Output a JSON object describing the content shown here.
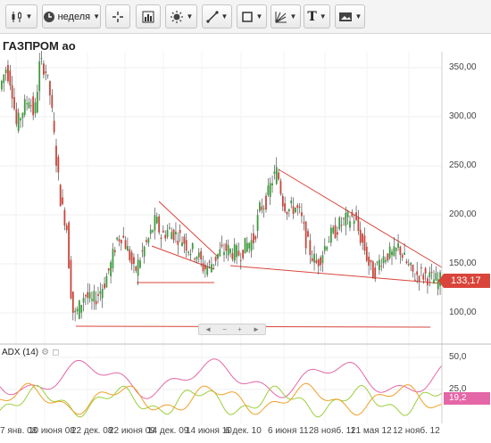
{
  "toolbar": {
    "period_label": "неделя",
    "buttons": [
      {
        "name": "chart-type-button",
        "icon": "candlestick-icon"
      },
      {
        "name": "period-button",
        "icon": "clock-icon"
      },
      {
        "name": "crosshair-button",
        "icon": "crosshair-icon"
      },
      {
        "name": "indicators-button",
        "icon": "bar-chart-icon"
      },
      {
        "name": "settings-button",
        "icon": "sun-gear-icon"
      },
      {
        "name": "draw-line-button",
        "icon": "line-tool-icon"
      },
      {
        "name": "shapes-button",
        "icon": "rectangle-icon"
      },
      {
        "name": "fib-button",
        "icon": "fibonacci-icon"
      },
      {
        "name": "text-button",
        "icon": "text-icon"
      },
      {
        "name": "image-button",
        "icon": "image-icon"
      }
    ]
  },
  "main_chart": {
    "title": "ГАЗПРОМ ао",
    "last_price": "133,17",
    "y_labels": [
      "350,00",
      "300,00",
      "250,00",
      "200,00",
      "150,00",
      "100,00"
    ],
    "colors": {
      "up": "#3f9a3f",
      "down": "#c7463b",
      "trendline": "#d9453b",
      "price_badge": "#d9453b"
    }
  },
  "scroller": {
    "left": "◄",
    "minus": "−",
    "plus": "+",
    "right": "►"
  },
  "adx_panel": {
    "title": "ADX (14)",
    "last_value": "19,2",
    "y_labels": [
      "50,0",
      "25,0"
    ],
    "colors": {
      "adx": "#e467a7",
      "plus_di": "#9ccf3c",
      "minus_di": "#f0a02a"
    }
  },
  "x_axis": {
    "labels": [
      "7 янв. 08",
      "10 июня 08",
      "22 дек. 08",
      "22 июня 09",
      "14 дек. 09",
      "14 июня 10",
      "6 дек. 10",
      "6 июня 11",
      "28 нояб. 11",
      "21 мая 12",
      "12 нояб. 12"
    ]
  }
}
